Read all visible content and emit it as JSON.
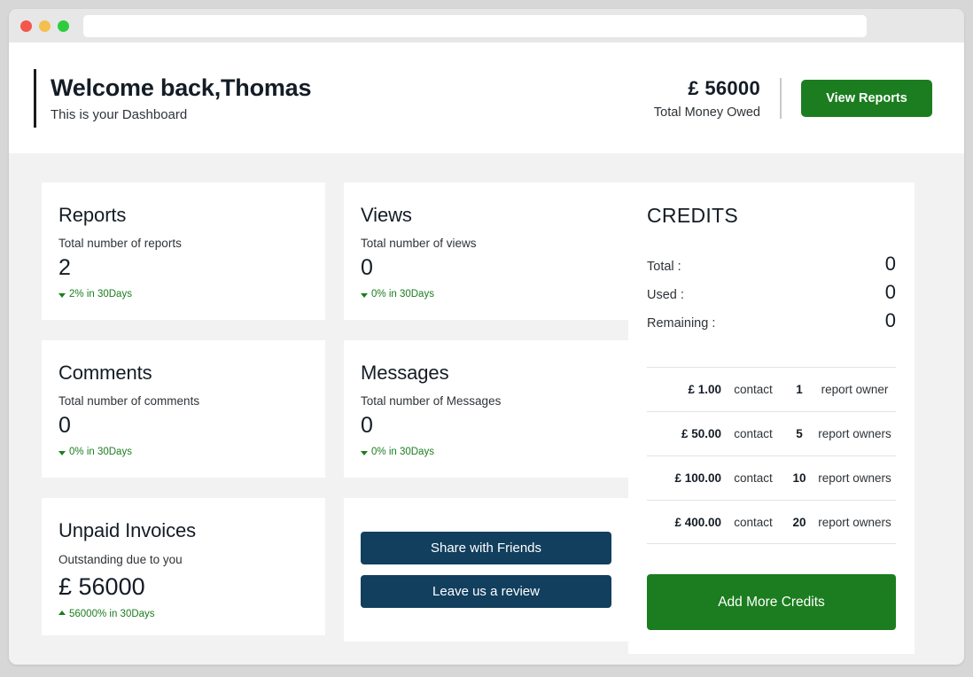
{
  "browser": {
    "address_value": "",
    "address_placeholder": ""
  },
  "header": {
    "title": "Welcome back,Thomas",
    "subtitle": "This is your Dashboard",
    "money_amount": "£ 56000",
    "money_label": "Total Money Owed",
    "view_reports_label": "View Reports",
    "accent_green": "#1b7d1f"
  },
  "stats": [
    {
      "title": "Reports",
      "subtitle": "Total number of reports",
      "value": "2",
      "delta": "2% in 30Days",
      "direction": "down"
    },
    {
      "title": "Views",
      "subtitle": "Total number of views",
      "value": "0",
      "delta": "0% in 30Days",
      "direction": "down"
    },
    {
      "title": "Comments",
      "subtitle": "Total number of comments",
      "value": "0",
      "delta": "0% in 30Days",
      "direction": "down"
    },
    {
      "title": "Messages",
      "subtitle": "Total number of Messages",
      "value": "0",
      "delta": "0% in 30Days",
      "direction": "down"
    }
  ],
  "invoices": {
    "title": "Unpaid Invoices",
    "subtitle": "Outstanding due to you",
    "value": "£ 56000",
    "delta": "56000% in 30Days",
    "direction": "up"
  },
  "share": {
    "share_label": "Share with Friends",
    "review_label": "Leave us a review",
    "button_color": "#123f5e"
  },
  "credits": {
    "title": "CREDITS",
    "summary": [
      {
        "label": "Total :",
        "value": "0"
      },
      {
        "label": "Used :",
        "value": "0"
      },
      {
        "label": "Remaining :",
        "value": "0"
      }
    ],
    "pricing": [
      {
        "price": "£ 1.00",
        "verb": "contact",
        "count": "1",
        "noun": "report owner"
      },
      {
        "price": "£ 50.00",
        "verb": "contact",
        "count": "5",
        "noun": "report owners"
      },
      {
        "price": "£ 100.00",
        "verb": "contact",
        "count": "10",
        "noun": "report owners"
      },
      {
        "price": "£ 400.00",
        "verb": "contact",
        "count": "20",
        "noun": "report owners"
      }
    ],
    "add_credits_label": "Add More Credits"
  }
}
